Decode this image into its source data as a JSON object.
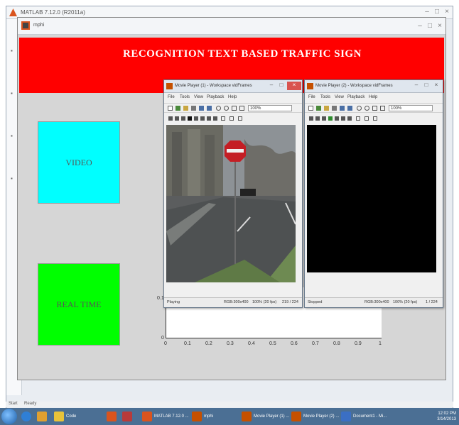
{
  "outer_window": {
    "title": "MATLAB 7.12.0 (R2011a)"
  },
  "figure": {
    "title": "mphi",
    "banner_text": "RECOGNITION TEXT BASED TRAFFIC SIGN",
    "banner_color": "#ff0000",
    "buttons": [
      {
        "label": "VIDEO",
        "color": "#00ffff"
      },
      {
        "label": "REAL TIME",
        "color": "#00ff00"
      }
    ]
  },
  "axes": {
    "x_ticks": [
      "0",
      "0.1",
      "0.2",
      "0.3",
      "0.4",
      "0.5",
      "0.6",
      "0.7",
      "0.8",
      "0.9",
      "1"
    ],
    "y_ticks": [
      "0.1",
      "0"
    ]
  },
  "player1": {
    "title": "Movie Player (1) - Workspace vidFrames",
    "menu": [
      "File",
      "Tools",
      "View",
      "Playback",
      "Help"
    ],
    "zoom": "100%",
    "status_left": "Playing",
    "status_rgb": "RGB:300x400",
    "status_frame": "100% (20 fps)",
    "status_count": "219 / 224"
  },
  "player2": {
    "title": "Movie Player (2) - Workspace vidFrames",
    "menu": [
      "File",
      "Tools",
      "View",
      "Playback",
      "Help"
    ],
    "zoom": "100%",
    "status_left": "Stopped",
    "status_rgb": "RGB:300x400",
    "status_frame": "100% (20 fps)",
    "status_count": "1 / 224"
  },
  "status_bar": {
    "start_label": "Start",
    "text": "Ready"
  },
  "taskbar": {
    "items": [
      {
        "label": "Code",
        "icon_color": "#e8c33a"
      },
      {
        "label": "",
        "icon_color": "#d9541e"
      },
      {
        "label": "",
        "icon_color": "#b83a3a"
      },
      {
        "label": "MATLAB 7.12.0 ...",
        "icon_color": "#d9541e"
      },
      {
        "label": "mphi",
        "icon_color": "#c55000"
      },
      {
        "label": "Movie Player (1) ...",
        "icon_color": "#c55000"
      },
      {
        "label": "Movie Player (2) ...",
        "icon_color": "#c55000"
      },
      {
        "label": "Document1 - Mi...",
        "icon_color": "#3b6fc4"
      }
    ],
    "clock_time": "12:02 PM",
    "clock_date": "3/14/2013"
  }
}
